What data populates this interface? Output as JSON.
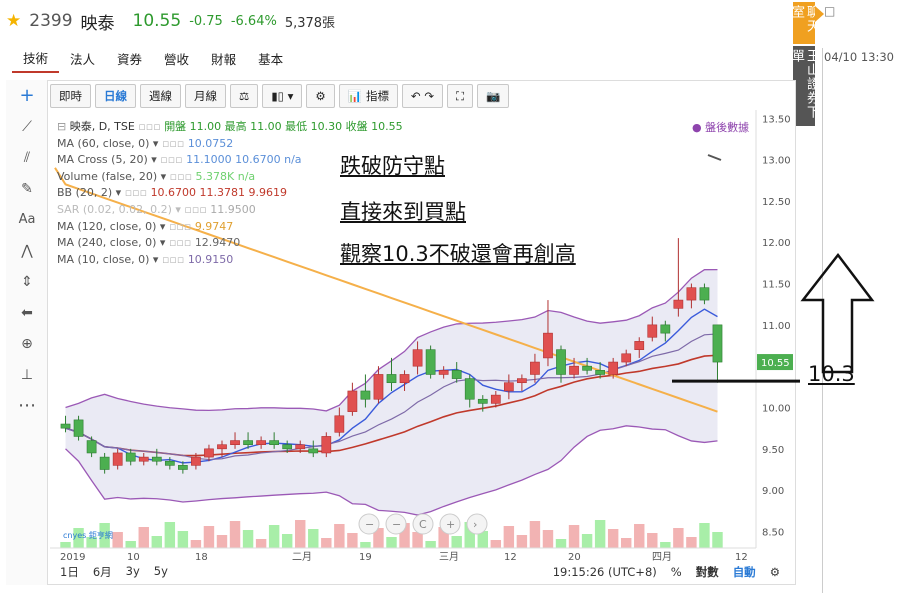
{
  "header": {
    "code": "2399",
    "name": "映泰",
    "price": "10.55",
    "change": "-0.75",
    "change_pct": "-6.64%",
    "volume": "5,378張",
    "datetime": "04/10 13:30"
  },
  "tabs": [
    "技術",
    "法人",
    "資券",
    "營收",
    "財報",
    "基本"
  ],
  "side_buttons": {
    "chat": "聊天室",
    "order": "玉山證券下單"
  },
  "toolbar": {
    "intraday": "即時",
    "daily": "日線",
    "weekly": "週線",
    "monthly": "月線",
    "indicator": "指標"
  },
  "legend": {
    "main": "映泰, D, TSE",
    "ohlc": "開盤 11.00 最高 11.00 最低 10.30 收盤 10.55",
    "after": "盤後數據",
    "rows": [
      {
        "label": "MA (60, close, 0)",
        "value": "10.0752",
        "color": "#5b8fd8"
      },
      {
        "label": "MA Cross (5, 20)",
        "value": "11.1000  10.6700  n/a",
        "color": "#5b8fd8"
      },
      {
        "label": "Volume (false, 20)",
        "value": "5.378K  n/a",
        "color": "#6fd16f"
      },
      {
        "label": "BB (20, 2)",
        "value": "10.6700  11.3781  9.9619",
        "color": "#c0392b"
      },
      {
        "label": "SAR (0.02, 0.02, 0.2)",
        "value": "11.9500",
        "color": "#aaa"
      },
      {
        "label": "MA (120, close, 0)",
        "value": "9.9747",
        "color": "#e0a030"
      },
      {
        "label": "MA (240, close, 0)",
        "value": "12.9470",
        "color": "#666"
      },
      {
        "label": "MA (10, close, 0)",
        "value": "10.9150",
        "color": "#7e6aa8"
      }
    ]
  },
  "annotations": {
    "line1": "跌破防守點",
    "line2": "直接來到買點",
    "line3": "觀察10.3不破還會再創高",
    "level": "10.3"
  },
  "price_axis": [
    "13.50",
    "13.00",
    "12.50",
    "12.00",
    "11.50",
    "11.00",
    "10.50",
    "10.00",
    "9.50",
    "9.00",
    "8.50"
  ],
  "last_price_tag": "10.55",
  "time_axis": [
    "2019",
    "10",
    "18",
    "二月",
    "19",
    "三月",
    "12",
    "20",
    "四月",
    "12"
  ],
  "bottom": {
    "ranges": [
      "1日",
      "6月",
      "3y",
      "5y"
    ],
    "clock": "19:15:26 (UTC+8)",
    "pct": "%",
    "log": "對數",
    "auto": "自動"
  },
  "logo_text": "cnyes 鉅亨網",
  "colors": {
    "up": "#e05050",
    "down": "#4caf50",
    "bb_fill": "#e8e8f3",
    "ma120": "#f5b04a"
  },
  "chart_data": {
    "type": "candlestick",
    "ylim": [
      8.3,
      13.6
    ],
    "candles": [
      [
        9.8,
        9.9,
        9.7,
        9.75
      ],
      [
        9.85,
        9.9,
        9.6,
        9.65
      ],
      [
        9.6,
        9.65,
        9.4,
        9.45
      ],
      [
        9.4,
        9.45,
        9.2,
        9.25
      ],
      [
        9.3,
        9.5,
        9.25,
        9.45
      ],
      [
        9.45,
        9.5,
        9.3,
        9.35
      ],
      [
        9.35,
        9.45,
        9.3,
        9.4
      ],
      [
        9.4,
        9.5,
        9.3,
        9.35
      ],
      [
        9.35,
        9.4,
        9.25,
        9.3
      ],
      [
        9.3,
        9.35,
        9.2,
        9.25
      ],
      [
        9.3,
        9.45,
        9.25,
        9.4
      ],
      [
        9.4,
        9.55,
        9.35,
        9.5
      ],
      [
        9.5,
        9.6,
        9.4,
        9.55
      ],
      [
        9.55,
        9.7,
        9.5,
        9.6
      ],
      [
        9.6,
        9.7,
        9.5,
        9.55
      ],
      [
        9.55,
        9.65,
        9.5,
        9.6
      ],
      [
        9.6,
        9.7,
        9.5,
        9.55
      ],
      [
        9.55,
        9.6,
        9.45,
        9.5
      ],
      [
        9.5,
        9.6,
        9.45,
        9.55
      ],
      [
        9.5,
        9.6,
        9.4,
        9.45
      ],
      [
        9.45,
        9.7,
        9.4,
        9.65
      ],
      [
        9.7,
        10.0,
        9.65,
        9.9
      ],
      [
        9.95,
        10.3,
        9.9,
        10.2
      ],
      [
        10.2,
        10.4,
        10.0,
        10.1
      ],
      [
        10.1,
        10.5,
        10.05,
        10.4
      ],
      [
        10.4,
        10.6,
        10.2,
        10.3
      ],
      [
        10.3,
        10.45,
        10.2,
        10.4
      ],
      [
        10.5,
        10.8,
        10.4,
        10.7
      ],
      [
        10.7,
        10.75,
        10.35,
        10.4
      ],
      [
        10.4,
        10.5,
        10.35,
        10.45
      ],
      [
        10.45,
        10.55,
        10.3,
        10.35
      ],
      [
        10.35,
        10.4,
        10.0,
        10.1
      ],
      [
        10.1,
        10.15,
        9.95,
        10.05
      ],
      [
        10.05,
        10.2,
        10.0,
        10.15
      ],
      [
        10.2,
        10.4,
        10.1,
        10.3
      ],
      [
        10.3,
        10.4,
        10.2,
        10.35
      ],
      [
        10.4,
        10.65,
        10.3,
        10.55
      ],
      [
        10.6,
        11.3,
        10.5,
        10.9
      ],
      [
        10.7,
        10.75,
        10.3,
        10.4
      ],
      [
        10.4,
        10.6,
        10.35,
        10.5
      ],
      [
        10.5,
        10.6,
        10.4,
        10.45
      ],
      [
        10.45,
        10.55,
        10.35,
        10.4
      ],
      [
        10.4,
        10.6,
        10.35,
        10.55
      ],
      [
        10.55,
        10.7,
        10.5,
        10.65
      ],
      [
        10.7,
        10.85,
        10.6,
        10.8
      ],
      [
        10.85,
        11.1,
        10.8,
        11.0
      ],
      [
        11.0,
        11.05,
        10.8,
        10.9
      ],
      [
        11.2,
        12.05,
        11.1,
        11.3
      ],
      [
        11.3,
        11.5,
        11.2,
        11.45
      ],
      [
        11.45,
        11.5,
        11.25,
        11.3
      ],
      [
        11.0,
        11.0,
        10.3,
        10.55
      ]
    ],
    "volume_max": 0.18
  }
}
